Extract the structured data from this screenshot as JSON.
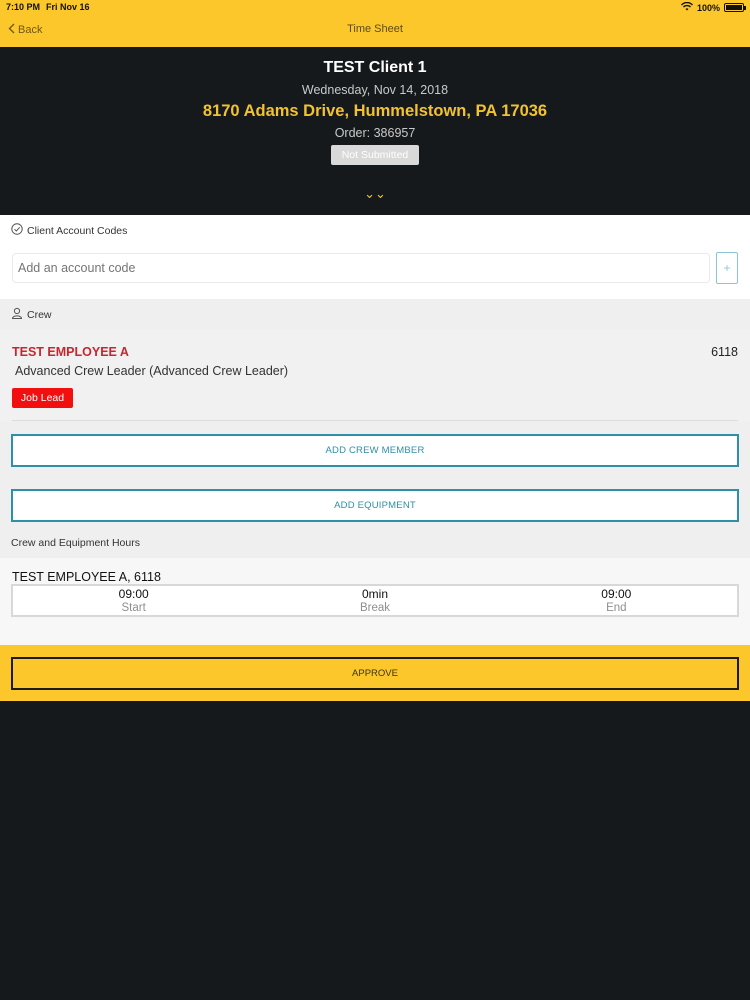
{
  "status_bar": {
    "time": "7:10 PM",
    "date": "Fri Nov 16",
    "battery": "100%"
  },
  "nav": {
    "back_label": "Back",
    "title": "Time Sheet"
  },
  "header": {
    "client": "TEST Client 1",
    "date": "Wednesday, Nov 14, 2018",
    "address": "8170 Adams Drive, Hummelstown, PA 17036",
    "order": "Order: 386957",
    "status_badge": "Not Submitted",
    "expand_glyph": "⌄⌄"
  },
  "account_codes": {
    "label": "Client Account Codes",
    "input_placeholder": "Add an account code",
    "add_glyph": "+"
  },
  "crew": {
    "label": "Crew",
    "members": [
      {
        "name": "TEST EMPLOYEE A",
        "id": "6118",
        "role": "Advanced Crew Leader (Advanced Crew Leader)",
        "tag": "Job Lead"
      }
    ],
    "add_crew_label": "ADD CREW MEMBER",
    "add_equipment_label": "ADD EQUIPMENT"
  },
  "hours": {
    "section_label": "Crew and Equipment Hours",
    "entries": [
      {
        "title": "TEST EMPLOYEE A, 6118",
        "start": "09:00",
        "start_label": "Start",
        "break": "0min",
        "break_label": "Break",
        "end": "09:00",
        "end_label": "End"
      }
    ]
  },
  "approve_label": "APPROVE",
  "colors": {
    "brand_yellow": "#fcc72a",
    "header_dark": "#15191b",
    "address_gold": "#f2c230",
    "employee_red": "#c8262c",
    "job_lead_red": "#f20f10",
    "button_teal": "#2e8fa8"
  }
}
